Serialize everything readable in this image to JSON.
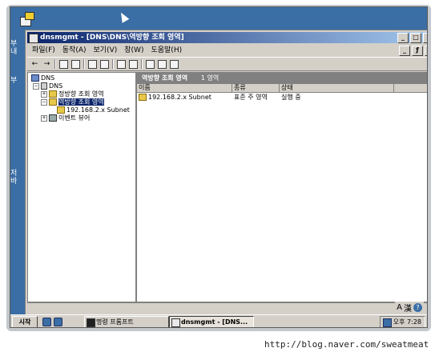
{
  "desktop": {
    "left_labels": [
      "부",
      "내",
      "부",
      "저",
      "바"
    ]
  },
  "window": {
    "title": "dnsmgmt - [DNS\\DNS\\역방향 조회 영역]",
    "caption_buttons": [
      "_",
      "□",
      "×"
    ],
    "mdi_buttons": [
      "_",
      "ƒ",
      "×"
    ],
    "menu": [
      "파일(F)",
      "동작(A)",
      "보기(V)",
      "창(W)",
      "도움말(H)"
    ],
    "toolbar": [
      {
        "icon": "back-icon",
        "glyph": "←"
      },
      {
        "icon": "forward-icon",
        "glyph": "→"
      },
      {
        "icon": "up-folder-icon",
        "glyph": "▭"
      },
      {
        "icon": "console-tree-icon",
        "glyph": "▤"
      },
      {
        "icon": "properties-icon",
        "glyph": "▯"
      },
      {
        "icon": "refresh-icon",
        "glyph": "↻"
      },
      {
        "icon": "export-icon",
        "glyph": "⇲"
      },
      {
        "icon": "help-icon",
        "glyph": "?"
      },
      {
        "icon": "server-icon",
        "glyph": "▮"
      },
      {
        "icon": "new-record-icon",
        "glyph": "▯"
      },
      {
        "icon": "new-zone-icon",
        "glyph": "▦"
      }
    ]
  },
  "tree": {
    "items": [
      {
        "label": "DNS",
        "icon": "dns-icon"
      },
      {
        "label": "DNS",
        "icon": "server-icon"
      },
      {
        "label": "정방향 조회 영역",
        "icon": "folder-icon"
      },
      {
        "label": "역방향 조회 영역",
        "icon": "folder-icon"
      },
      {
        "label": "192.168.2.x Subnet",
        "icon": "zone-icon"
      },
      {
        "label": "이벤트 뷰어",
        "icon": "event-viewer-icon"
      }
    ]
  },
  "details": {
    "header": "역방향 조회 영역",
    "count": "1 영역",
    "columns": [
      "이름",
      "종류",
      "상태"
    ],
    "rows": [
      {
        "name": "192.168.2.x Subnet",
        "type": "표준 주 영역",
        "status": "실행 중"
      }
    ]
  },
  "ime": {
    "lang": "A",
    "hanja": "漢"
  },
  "taskbar": {
    "start": "시작",
    "tasks": [
      "명령 프롬프트",
      "dnsmgmt - [DNS..."
    ],
    "clock": "오후 7:28"
  },
  "watermark": "http://blog.naver.com/sweatmeat"
}
